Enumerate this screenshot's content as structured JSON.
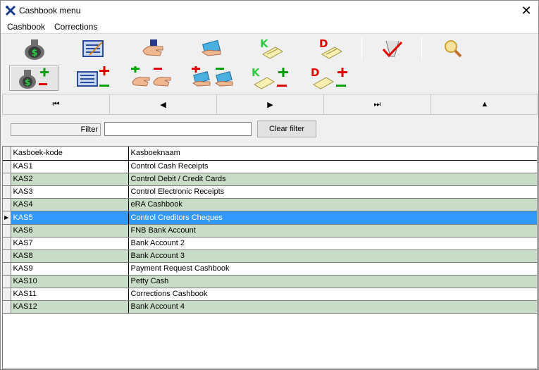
{
  "window": {
    "title": "Cashbook menu",
    "close_glyph": "✕"
  },
  "menubar": {
    "items": [
      "Cashbook",
      "Corrections"
    ]
  },
  "nav": {
    "first": "⏮",
    "prev": "◀",
    "next": "▶",
    "last": "⏭",
    "up": "▲"
  },
  "filter": {
    "label": "Filter",
    "value": "",
    "clear_label": "Clear filter"
  },
  "grid": {
    "columns": [
      "Kasboek-kode",
      "Kasboeknaam"
    ],
    "rows": [
      {
        "code": "KAS1",
        "name": "Control Cash Receipts"
      },
      {
        "code": "KAS2",
        "name": "Control Debit / Credit Cards"
      },
      {
        "code": "KAS3",
        "name": "Control Electronic Receipts"
      },
      {
        "code": "KAS4",
        "name": "eRA Cashbook"
      },
      {
        "code": "KAS5",
        "name": "Control Creditors Cheques"
      },
      {
        "code": "KAS6",
        "name": "FNB Bank Account"
      },
      {
        "code": "KAS7",
        "name": "Bank Account 2"
      },
      {
        "code": "KAS8",
        "name": "Bank Account 3"
      },
      {
        "code": "KAS9",
        "name": "Payment Request Cashbook"
      },
      {
        "code": "KAS10",
        "name": "Petty Cash"
      },
      {
        "code": "KAS11",
        "name": "Corrections Cashbook"
      },
      {
        "code": "KAS12",
        "name": "Bank Account 4"
      }
    ],
    "selected_index": 4
  },
  "colors": {
    "selection": "#3399ff",
    "alt_row": "#c8dcc8",
    "plus": "#00a000",
    "minus": "#e00000"
  },
  "toolbar_icons": [
    "money-bag-icon",
    "ledger-icon",
    "hand-icon",
    "cards-icon",
    "kredit-icon",
    "debit-icon",
    "checkmark-ruler-icon",
    "search-icon"
  ]
}
